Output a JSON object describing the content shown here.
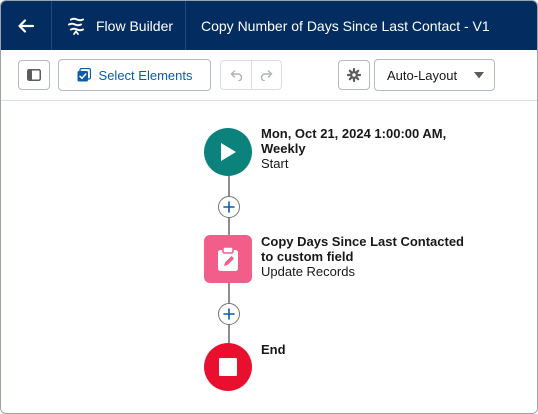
{
  "header": {
    "back_icon": "arrow-left-icon",
    "app_icon": "flow-icon",
    "app_name": "Flow Builder",
    "flow_title": "Copy Number of Days Since Last Contact - V1",
    "bg_color": "#032d60"
  },
  "toolbar": {
    "panel_icon": "panel-toggle-icon",
    "select_label": "Select Elements",
    "select_icon": "checkbox-multi-icon",
    "undo_icon": "undo-icon",
    "redo_icon": "redo-icon",
    "settings_icon": "gear-icon",
    "layout_value": "Auto-Layout",
    "layout_caret_icon": "caret-down-icon",
    "accent_color": "#0b5cab"
  },
  "flow": {
    "start": {
      "title": "Mon, Oct 21, 2024 1:00:00 AM,\nWeekly",
      "type": "Start",
      "icon": "play-icon",
      "color": "#0b827c"
    },
    "update": {
      "title": "Copy Days Since Last Contacted\nto custom field",
      "type": "Update Records",
      "icon": "clipboard-edit-icon",
      "color": "#f35d8a"
    },
    "end": {
      "title": "End",
      "icon": "stop-icon",
      "color": "#e8102e"
    },
    "add_icon": "plus-icon"
  }
}
